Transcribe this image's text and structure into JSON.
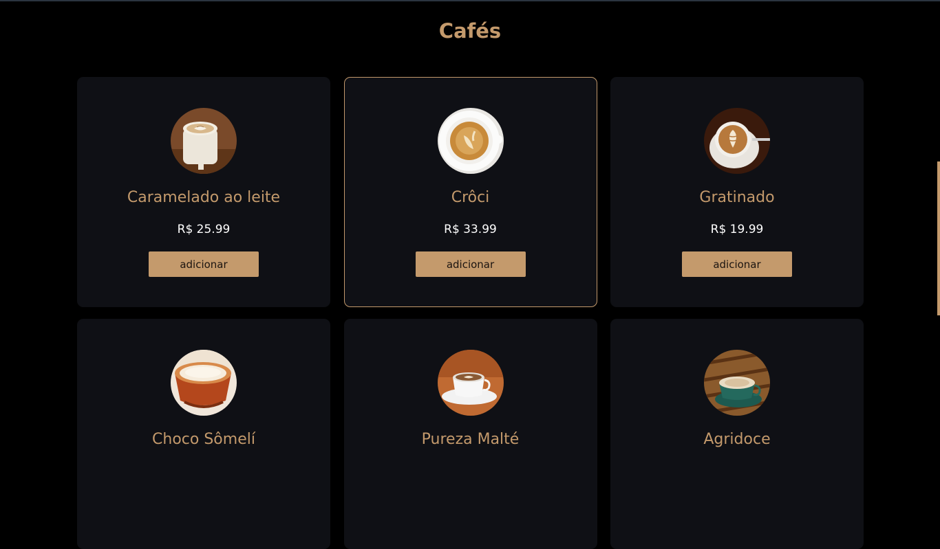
{
  "page": {
    "title": "Cafés"
  },
  "products": [
    {
      "name": "Caramelado ao leite",
      "price": "R$ 25.99",
      "button": "adicionar",
      "image": "latte-art-mug-icon",
      "selected": false
    },
    {
      "name": "Crôci",
      "price": "R$ 33.99",
      "button": "adicionar",
      "image": "cappuccino-cup-icon",
      "selected": true
    },
    {
      "name": "Gratinado",
      "price": "R$ 19.99",
      "button": "adicionar",
      "image": "latte-art-cup-icon",
      "selected": false
    },
    {
      "name": "Choco Sômelí",
      "price": "",
      "button": "",
      "image": "mocha-cup-icon",
      "selected": false
    },
    {
      "name": "Pureza Malté",
      "price": "",
      "button": "",
      "image": "white-coffee-cup-icon",
      "selected": false
    },
    {
      "name": "Agridoce",
      "price": "",
      "button": "",
      "image": "green-coffee-cup-icon",
      "selected": false
    }
  ],
  "colors": {
    "accent": "#c49a6c",
    "background": "#000000",
    "card": "#0f1015",
    "text": "#ffffff"
  }
}
